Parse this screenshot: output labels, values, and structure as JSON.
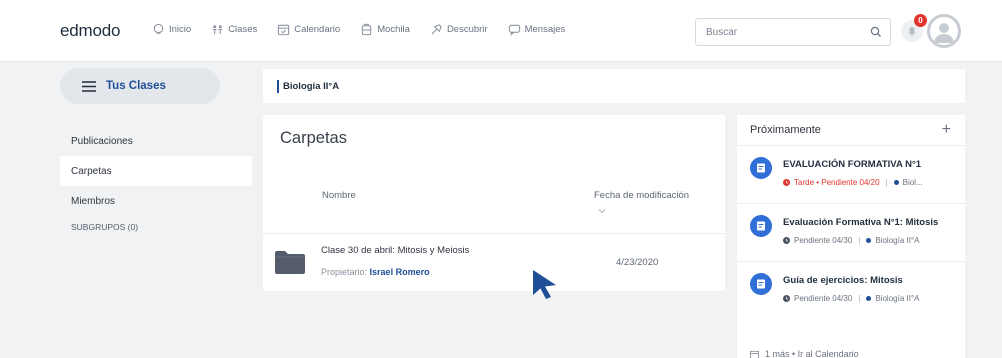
{
  "header": {
    "logo": "edmodo",
    "nav": [
      {
        "label": "Inicio",
        "icon": "home-icon"
      },
      {
        "label": "Clases",
        "icon": "classes-icon"
      },
      {
        "label": "Calendario",
        "icon": "calendar-icon"
      },
      {
        "label": "Mochila",
        "icon": "backpack-icon"
      },
      {
        "label": "Descubrir",
        "icon": "discover-icon"
      },
      {
        "label": "Mensajes",
        "icon": "messages-icon"
      }
    ],
    "search_placeholder": "Buscar",
    "notification_count": "0"
  },
  "sidebar": {
    "classes_button": "Tus Clases",
    "items": [
      {
        "label": "Publicaciones",
        "active": false
      },
      {
        "label": "Carpetas",
        "active": true
      },
      {
        "label": "Miembros",
        "active": false
      }
    ],
    "subgroups_label": "SUBGRUPOS (0)"
  },
  "breadcrumb": {
    "class_name": "Biología II°A"
  },
  "folders": {
    "title": "Carpetas",
    "col_name": "Nombre",
    "col_date": "Fecha de modificación",
    "rows": [
      {
        "name": "Clase 30 de abril: Mitosis y Meiosis",
        "owner_label": "Propietario:",
        "owner": "Israel Romero",
        "date": "4/23/2020"
      }
    ]
  },
  "upcoming": {
    "title": "Próximamente",
    "add_label": "+",
    "items": [
      {
        "title": "EVALUACIÓN FORMATIVA N°1",
        "status": "Tarde • Pendiente 04/20",
        "late": true,
        "class": "Biol..."
      },
      {
        "title": "Evaluación Formativa N°1: Mitosis",
        "status": "Pendiente 04/30",
        "late": false,
        "class": "Biología II°A"
      },
      {
        "title": "Guía de ejercicios: Mitosis",
        "status": "Pendiente 04/30",
        "late": false,
        "class": "Biología II°A"
      }
    ],
    "footer": "1 más • Ir al Calendario"
  },
  "colors": {
    "accent": "#1f4f97",
    "badge": "#e0342d",
    "background": "#f1f2f4"
  }
}
